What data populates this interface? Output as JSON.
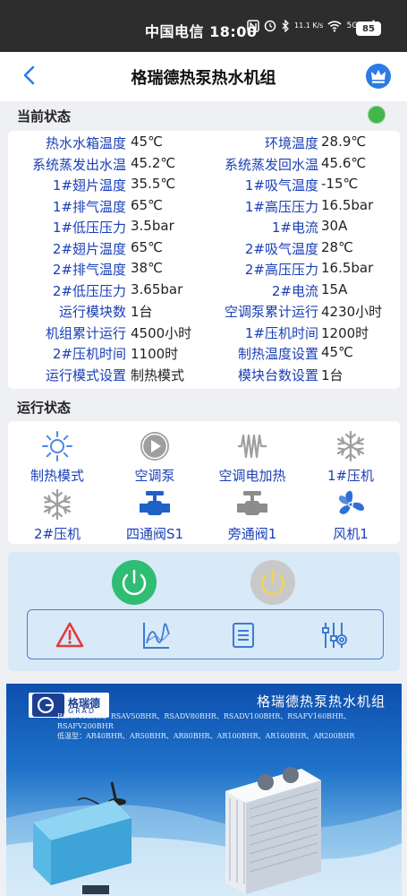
{
  "status_bar": {
    "carrier_time": "中国电信 18:00",
    "speed": "11.1 K/s",
    "network": "5G",
    "battery": "85"
  },
  "header": {
    "title": "格瑞德热泵热水机组"
  },
  "current_state": {
    "label": "当前状态",
    "indicator_color": "#43b649",
    "rows": [
      {
        "l1": "热水水箱温度",
        "v1": "45℃",
        "l2": "环境温度",
        "v2": "28.9℃"
      },
      {
        "l1": "系统蒸发出水温",
        "v1": "45.2℃",
        "l2": "系统蒸发回水温",
        "v2": "45.6℃"
      },
      {
        "l1": "1#翅片温度",
        "v1": "35.5℃",
        "l2": "1#吸气温度",
        "v2": "-15℃"
      },
      {
        "l1": "1#排气温度",
        "v1": "65℃",
        "l2": "1#高压压力",
        "v2": "16.5bar"
      },
      {
        "l1": "1#低压压力",
        "v1": "3.5bar",
        "l2": "1#电流",
        "v2": "30A"
      },
      {
        "l1": "2#翅片温度",
        "v1": "65℃",
        "l2": "2#吸气温度",
        "v2": "28℃"
      },
      {
        "l1": "2#排气温度",
        "v1": "38℃",
        "l2": "2#高压压力",
        "v2": "16.5bar"
      },
      {
        "l1": "2#低压压力",
        "v1": "3.65bar",
        "l2": "2#电流",
        "v2": "15A"
      },
      {
        "l1": "运行模块数",
        "v1": "1台",
        "l2": "空调泵累计运行",
        "v2": "4230小时"
      },
      {
        "l1": "机组累计运行",
        "v1": "4500小时",
        "l2": "1#压机时间",
        "v2": "1200时"
      },
      {
        "l1": "2#压机时间",
        "v1": "1100时",
        "l2": "制热温度设置",
        "v2": "45℃"
      },
      {
        "l1": "运行模式设置",
        "v1": "制热模式",
        "l2": "模块台数设置",
        "v2": "1台"
      }
    ]
  },
  "run_state": {
    "label": "运行状态",
    "items": [
      {
        "label": "制热模式",
        "icon": "sun-icon"
      },
      {
        "label": "空调泵",
        "icon": "play-icon"
      },
      {
        "label": "空调电加热",
        "icon": "heater-icon"
      },
      {
        "label": "1#压机",
        "icon": "snowflake-icon"
      },
      {
        "label": "2#压机",
        "icon": "snowflake-icon"
      },
      {
        "label": "四通阀S1",
        "icon": "valve-icon"
      },
      {
        "label": "旁通阀1",
        "icon": "valve-icon"
      },
      {
        "label": "风机1",
        "icon": "fan-icon"
      }
    ]
  },
  "controls": {
    "power_on_color": "#2ebd73",
    "power_off_color": "#c9c9c9",
    "tools": [
      "alarm-icon",
      "chart-icon",
      "list-icon",
      "settings-sliders-icon"
    ]
  },
  "banner": {
    "logo_cn": "格瑞德",
    "logo_en": "GRAD",
    "title": "格瑞德热泵热水机组",
    "models_line1": "RSAV40BHR、RSAV50BHR、RSADV80BHR、RSADV100BHR、RSAFV160BHR、RSAFV200BHR",
    "models_line2": "低温型：AR40BHR、AR50BHR、AR80BHR、AR100BHR、AR160BHR、AR200BHR"
  }
}
